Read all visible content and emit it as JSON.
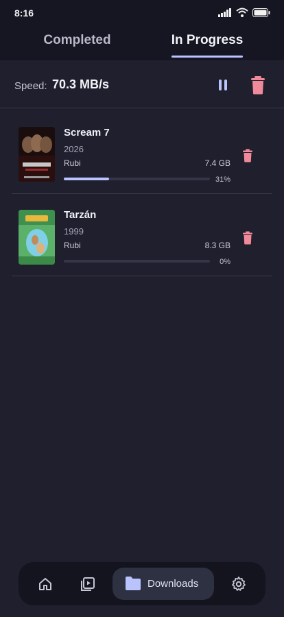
{
  "status_bar": {
    "time": "8:16",
    "icons": [
      "signal-icon",
      "wifi-icon",
      "battery-icon"
    ]
  },
  "tabs": [
    {
      "label": "Completed",
      "active": false
    },
    {
      "label": "In Progress",
      "active": true
    }
  ],
  "speed": {
    "label": "Speed:",
    "value": "70.3 MB/s"
  },
  "downloads": [
    {
      "title": "Scream 7",
      "year": "2026",
      "source": "Rubi",
      "size": "7.4 GB",
      "progress_text": "31%",
      "progress": 0.31
    },
    {
      "title": "Tarzán",
      "year": "1999",
      "source": "Rubi",
      "size": "8.3 GB",
      "progress_text": "0%",
      "progress": 0.0
    }
  ],
  "bottom_nav": {
    "items": [
      "home-icon",
      "player-icon",
      "folder-icon",
      "settings-icon"
    ],
    "active_label": "Downloads"
  },
  "colors": {
    "accent": "#b9c4ff",
    "danger": "#f08a9a",
    "background": "#1f1f2e"
  }
}
